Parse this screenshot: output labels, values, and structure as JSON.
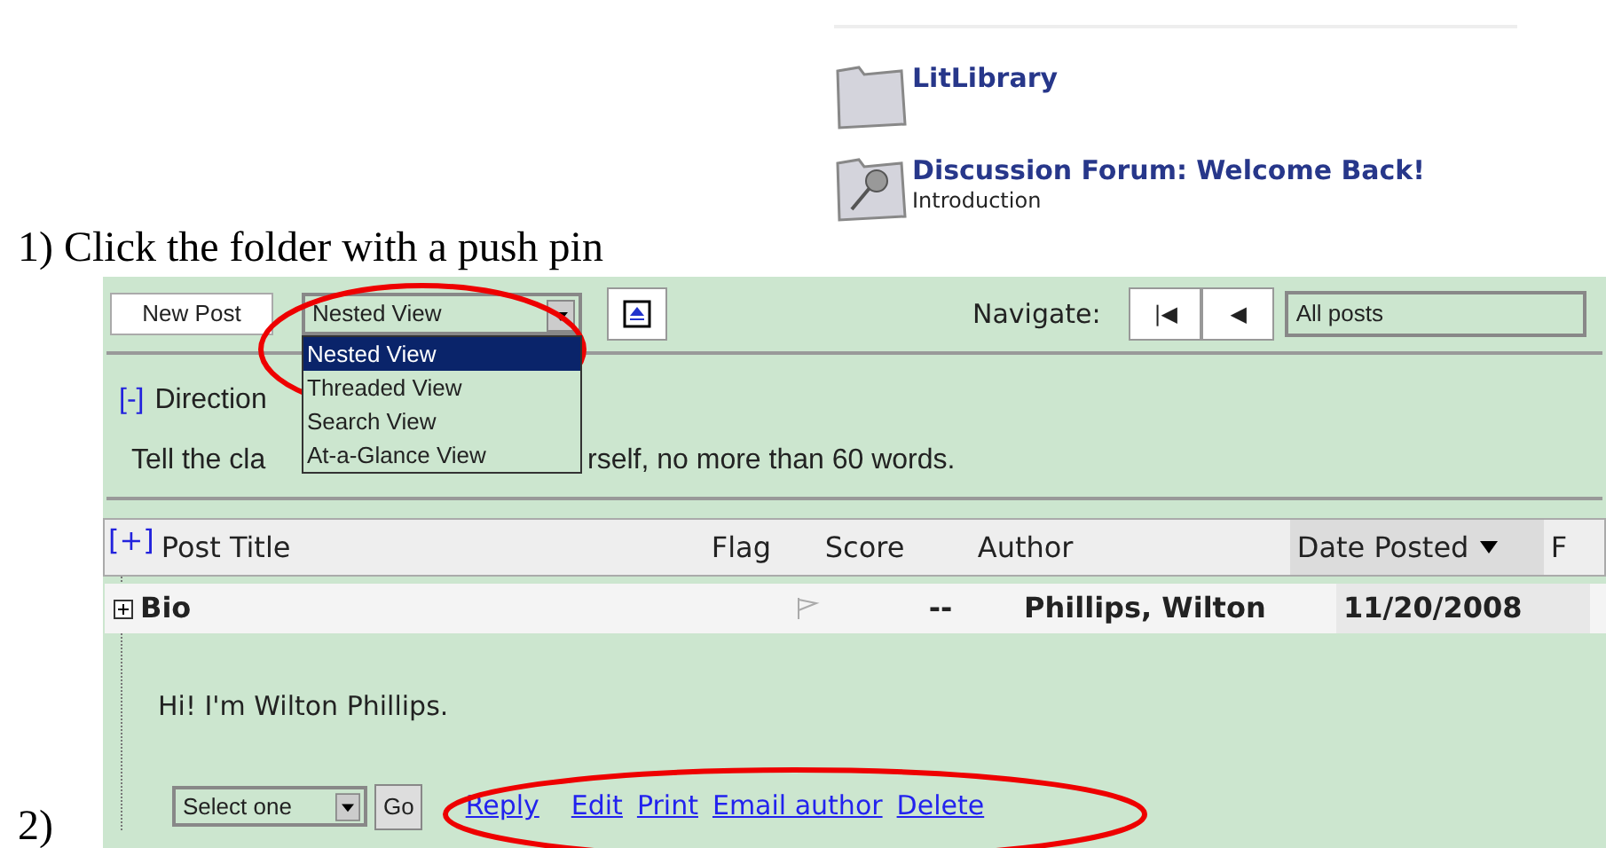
{
  "folders": [
    {
      "kind": "plain",
      "title": "LitLibrary"
    },
    {
      "kind": "pinned",
      "title": "Discussion Forum: Welcome Back!",
      "subtitle": "Introduction"
    }
  ],
  "step_1": "1) Click the folder with a push pin",
  "step_2": "2)",
  "forum": {
    "new_post": "New Post",
    "view_select": {
      "value": "Nested View",
      "expanded": true,
      "options": [
        {
          "label": "Nested View",
          "selected": true
        },
        {
          "label": "Threaded View",
          "selected": false
        },
        {
          "label": "Search View",
          "selected": false
        },
        {
          "label": "At-a-Glance View",
          "selected": false
        }
      ]
    },
    "navigate_label": "Navigate:",
    "nav_buttons": [
      "|◀",
      "◀"
    ],
    "filter_select": "All posts",
    "directions": {
      "toggle": "[-]",
      "title": "Direction",
      "text_before": "Tell the cla",
      "text_after": "rself, no more than 60 words."
    },
    "table": {
      "expand_all": "[+]",
      "columns": [
        {
          "label": "Post Title",
          "sorted": false
        },
        {
          "label": "Flag",
          "sorted": false
        },
        {
          "label": "Score",
          "sorted": false
        },
        {
          "label": "Author",
          "sorted": false
        },
        {
          "label": "Date Posted",
          "sorted": true
        },
        {
          "label": "F",
          "sorted": false
        }
      ],
      "rows": [
        {
          "title": "Bio",
          "expanded": false,
          "flagged": false,
          "score": "--",
          "author": "Phillips, Wilton",
          "date": "11/20/2008",
          "body": "Hi! I'm Wilton Phillips.",
          "action_select": "Select one",
          "go": "Go",
          "links": [
            "Reply",
            "Edit",
            "Print",
            "Email author",
            "Delete"
          ]
        }
      ]
    }
  }
}
